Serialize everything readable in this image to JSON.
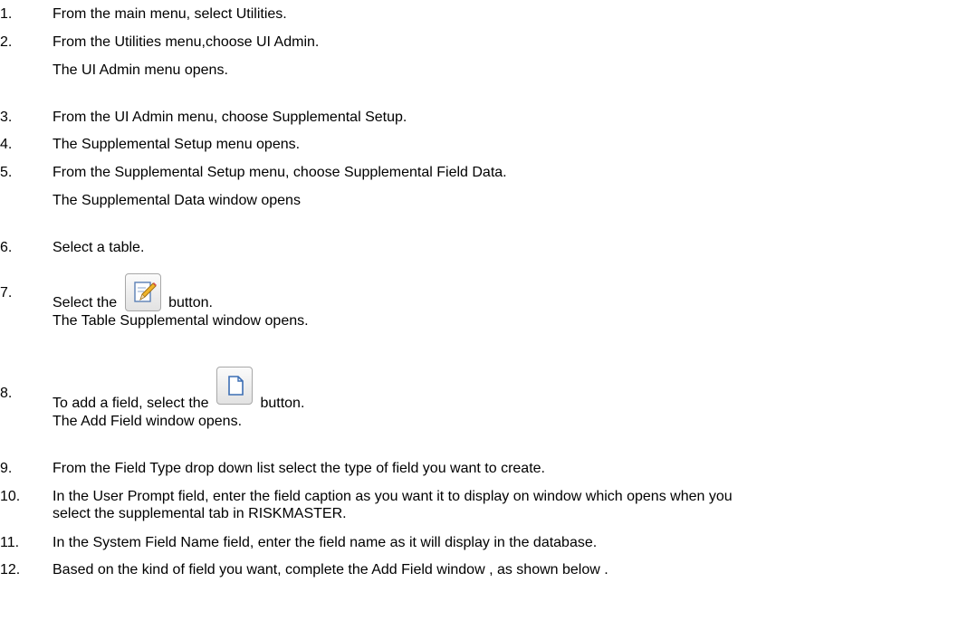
{
  "steps": [
    {
      "num": "1.",
      "text": "From the main menu, select Utilities."
    },
    {
      "num": "2.",
      "text": "From the Utilities menu,choose UI Admin.",
      "note": "The UI Admin menu opens."
    },
    {
      "num": "3.",
      "text": "From the UI Admin menu, choose Supplemental Setup."
    },
    {
      "num": "4.",
      "text": "The Supplemental Setup menu opens."
    },
    {
      "num": "5.",
      "text": "From the Supplemental Setup menu, choose Supplemental Field Data.",
      "note": "The Supplemental Data window opens"
    },
    {
      "num": "6.",
      "text": "Select a table."
    },
    {
      "num": "7.",
      "text_before": "Select the",
      "text_after": "button.",
      "icon": "edit-pencil-icon",
      "note": "The Table Supplemental window opens."
    },
    {
      "num": "8.",
      "text_before": "To add a field, select the",
      "text_after": "button.",
      "icon": "new-document-icon",
      "note": "The Add Field window opens."
    },
    {
      "num": "9.",
      "text": "From the Field Type drop down list select the type of field you want to create."
    },
    {
      "num": "10.",
      "text": "In the User Prompt field, enter the field caption as you want it to display on window which opens when you",
      "text2": "select the supplemental tab in RISKMASTER."
    },
    {
      "num": "11.",
      "text": "In the System Field Name field, enter the field name as it will display in the database."
    },
    {
      "num": "12.",
      "text": "Based on the kind of field you want, complete the Add Field window , as shown below ."
    }
  ]
}
